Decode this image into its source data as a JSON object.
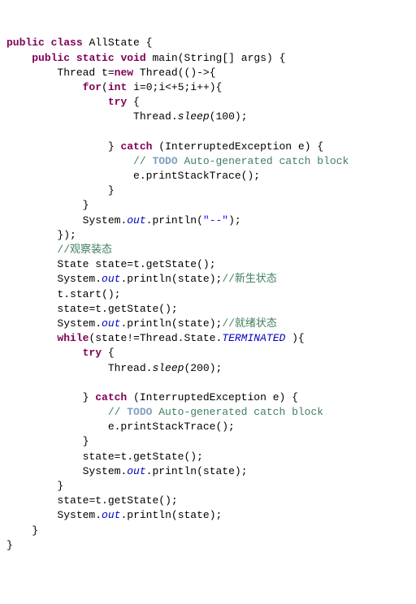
{
  "colors": {
    "keyword": "#7f0055",
    "string": "#2a00ff",
    "comment": "#3f7f5f",
    "field": "#0000c0",
    "todo": "#7f9fbf"
  },
  "t": {
    "public": "public",
    "class": "class",
    "className": "AllState",
    "static": "static",
    "void": "void",
    "main": "main",
    "stringArr": "String[]",
    "args": "args",
    "Thread": "Thread",
    "tvar": "t",
    "new": "new",
    "arrow": "()->{",
    "for": "for",
    "int": "int",
    "i": "i",
    "zero": "0",
    "cond": "i<+5",
    "inc": "i++",
    "try": "try",
    "sleep": "sleep",
    "hundred": "100",
    "catch": "catch",
    "exc": "InterruptedException",
    "evar": "e",
    "todoPrefix": "// ",
    "todoWord": "TODO",
    "todoRest": " Auto-generated catch block",
    "printStack": "e.printStackTrace();",
    "System": "System",
    "out": "out",
    "println": "println",
    "ddash": "\"--\"",
    "obsComment": "//观察装态",
    "State": "State",
    "state": "state",
    "getState": "t.getState();",
    "newbornComment": "//新生状态",
    "tstart": "t.start();",
    "readyComment": "//就绪状态",
    "while": "while",
    "neq": "state!=Thread.State.",
    "terminated": "TERMINATED",
    "twoHundred": "200"
  }
}
